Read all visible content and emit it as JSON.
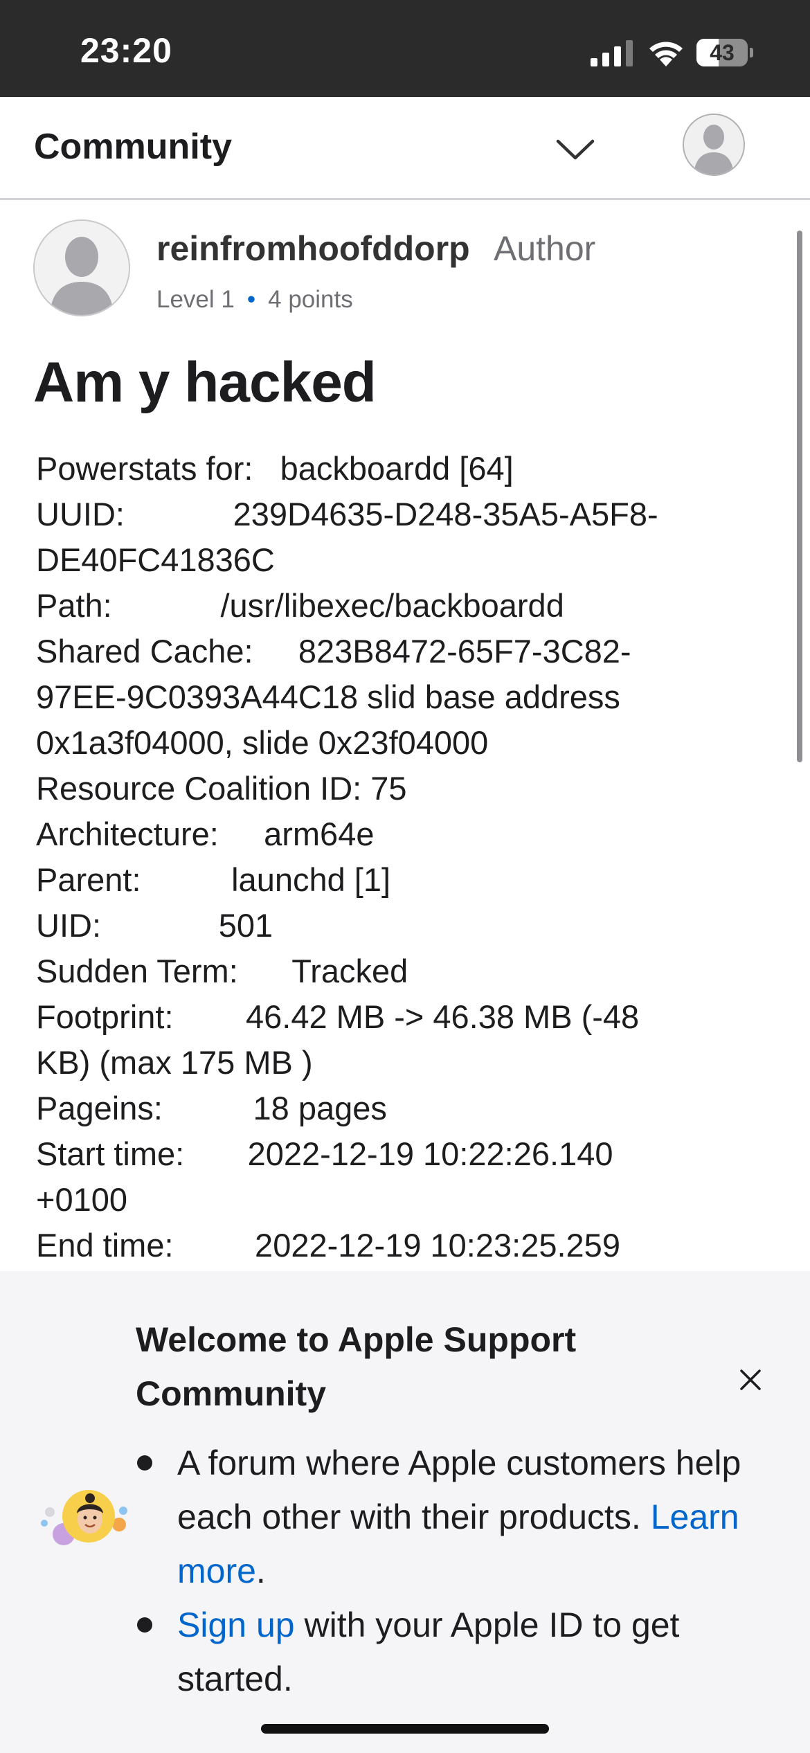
{
  "status_bar": {
    "time": "23:20",
    "battery_level": "43",
    "battery_fraction": 0.43,
    "icons": [
      "signal-icon",
      "wifi-icon",
      "battery-icon"
    ]
  },
  "header": {
    "title": "Community",
    "icons": [
      "chevron-down-icon",
      "avatar-icon"
    ]
  },
  "post": {
    "author": {
      "username": "reinfromhoofddorp",
      "badge": "Author",
      "level": "Level 1",
      "points": "4 points"
    },
    "title": "Am y hacked",
    "body_lines": [
      "Powerstats for:   backboardd [64]",
      "UUID:            239D4635-D248-35A5-A5F8-",
      "DE40FC41836C",
      "Path:            /usr/libexec/backboardd",
      "Shared Cache:     823B8472-65F7-3C82-",
      "97EE-9C0393A44C18 slid base address",
      "0x1a3f04000, slide 0x23f04000",
      "Resource Coalition ID: 75",
      "Architecture:     arm64e",
      "Parent:          launchd [1]",
      "UID:             501",
      "Sudden Term:      Tracked",
      "Footprint:        46.42 MB -> 46.38 MB (-48",
      "KB) (max 175 MB )",
      "Pageins:          18 pages",
      "Start time:       2022-12-19 10:22:26.140",
      "+0100",
      "End time:         2022-12-19 10:23:25.259"
    ]
  },
  "welcome": {
    "title": "Welcome to Apple Support Community",
    "item1_text": "A forum where Apple customers help each other with their products. ",
    "item1_link": "Learn more",
    "item1_end": ".",
    "item2_link": "Sign up",
    "item2_text": " with your Apple ID to get started.",
    "icons": [
      "close-icon",
      "memoji-icon"
    ]
  },
  "colors": {
    "status_bar_bg": "#2b2b2b",
    "link": "#0066cc",
    "sheet_bg": "#f5f5f7"
  }
}
